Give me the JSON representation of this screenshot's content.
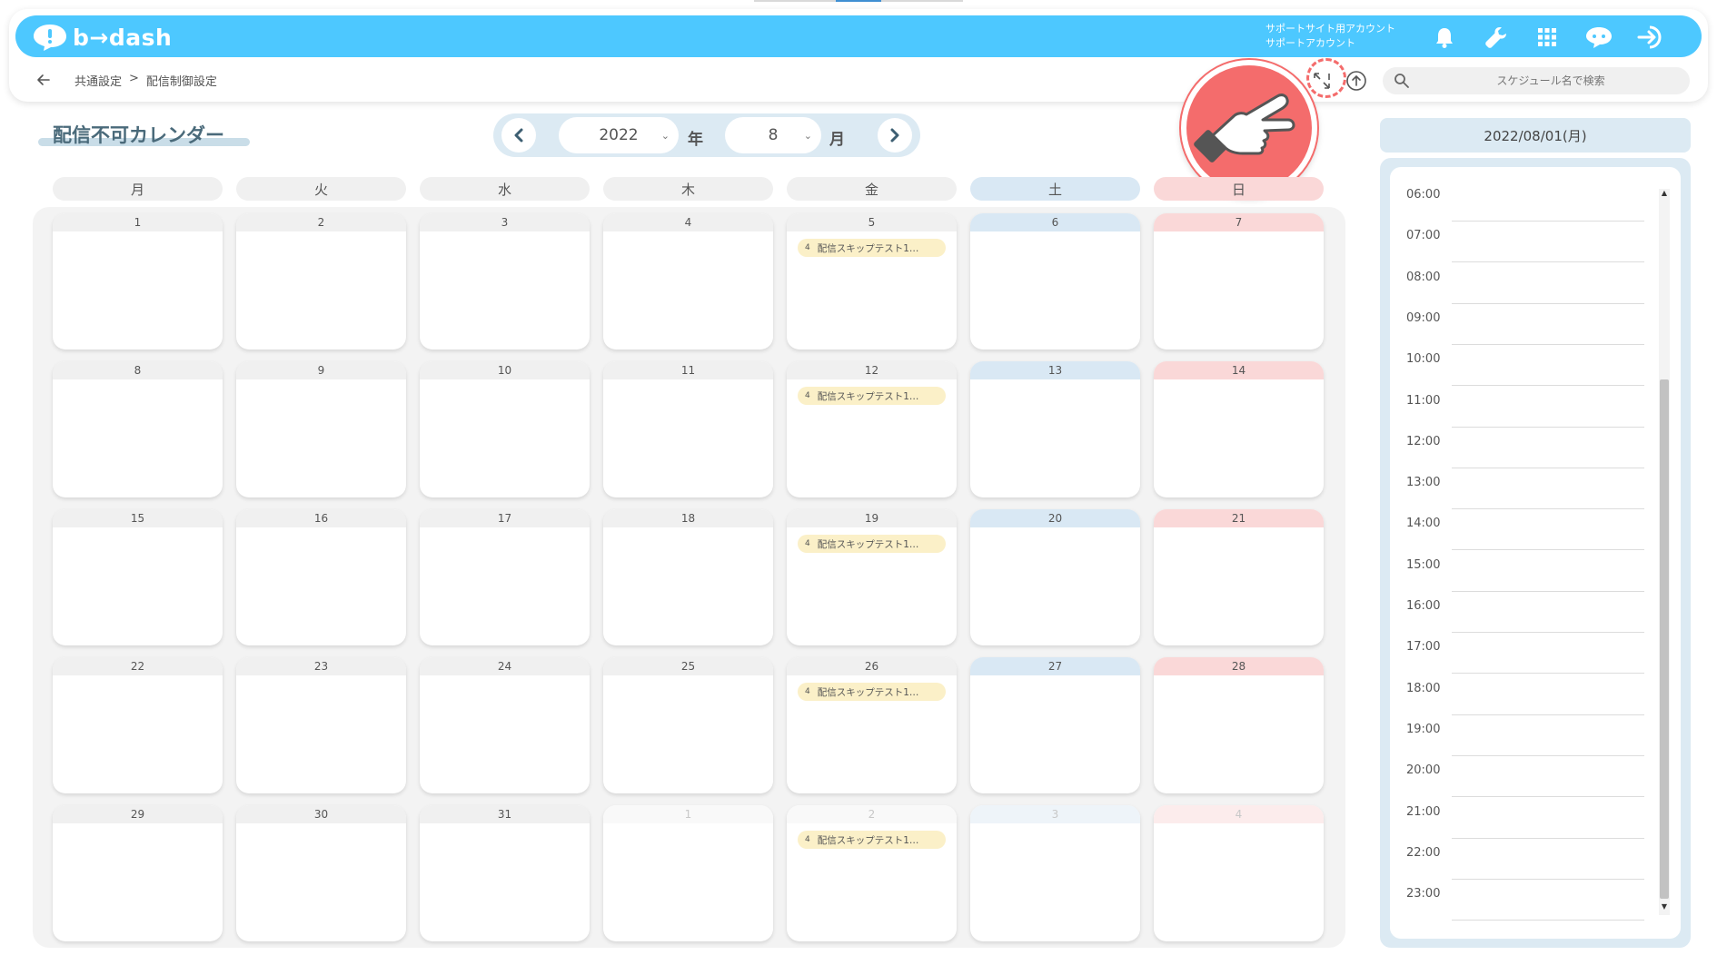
{
  "header": {
    "logo_text": "b→dash",
    "account_line1": "サポートサイト用アカウント",
    "account_line2": "サポートアカウント",
    "icons": [
      "bell-icon",
      "wrench-icon",
      "grid-icon",
      "chat-bot-icon",
      "logout-icon"
    ]
  },
  "breadcrumb": {
    "items": [
      "共通設定",
      ">",
      "配信制御設定"
    ]
  },
  "toolbar": {
    "icons": [
      "expand-icon",
      "upload-icon"
    ],
    "search_placeholder": "スケジュール名で検索"
  },
  "page": {
    "title": "配信不可カレンダー"
  },
  "selector": {
    "year": "2022",
    "year_suffix": "年",
    "month": "8",
    "month_suffix": "月"
  },
  "calendar": {
    "weekdays": [
      "月",
      "火",
      "水",
      "木",
      "金",
      "土",
      "日"
    ],
    "weeks": [
      [
        {
          "day": "1"
        },
        {
          "day": "2"
        },
        {
          "day": "3"
        },
        {
          "day": "4"
        },
        {
          "day": "5",
          "event": "配信スキップテスト1…",
          "count": "4"
        },
        {
          "day": "6"
        },
        {
          "day": "7"
        }
      ],
      [
        {
          "day": "8"
        },
        {
          "day": "9"
        },
        {
          "day": "10"
        },
        {
          "day": "11"
        },
        {
          "day": "12",
          "event": "配信スキップテスト1…",
          "count": "4"
        },
        {
          "day": "13"
        },
        {
          "day": "14"
        }
      ],
      [
        {
          "day": "15"
        },
        {
          "day": "16"
        },
        {
          "day": "17"
        },
        {
          "day": "18"
        },
        {
          "day": "19",
          "event": "配信スキップテスト1…",
          "count": "4"
        },
        {
          "day": "20"
        },
        {
          "day": "21"
        }
      ],
      [
        {
          "day": "22"
        },
        {
          "day": "23"
        },
        {
          "day": "24"
        },
        {
          "day": "25"
        },
        {
          "day": "26",
          "event": "配信スキップテスト1…",
          "count": "4"
        },
        {
          "day": "27"
        },
        {
          "day": "28"
        }
      ],
      [
        {
          "day": "29"
        },
        {
          "day": "30"
        },
        {
          "day": "31"
        },
        {
          "day": "1",
          "other": true
        },
        {
          "day": "2",
          "other": true,
          "event": "配信スキップテスト1…",
          "count": "4"
        },
        {
          "day": "3",
          "other": true
        },
        {
          "day": "4",
          "other": true
        }
      ]
    ]
  },
  "side": {
    "date": "2022/08/01(月)",
    "times": [
      "06:00",
      "07:00",
      "08:00",
      "09:00",
      "10:00",
      "11:00",
      "12:00",
      "13:00",
      "14:00",
      "15:00",
      "16:00",
      "17:00",
      "18:00",
      "19:00",
      "20:00",
      "21:00",
      "22:00",
      "23:00"
    ]
  },
  "colors": {
    "header": "#4dc8ff",
    "saturday": "#d9e8f4",
    "sunday": "#fad8d8",
    "event": "#fbf0c8",
    "pointer": "#f46c6c"
  }
}
